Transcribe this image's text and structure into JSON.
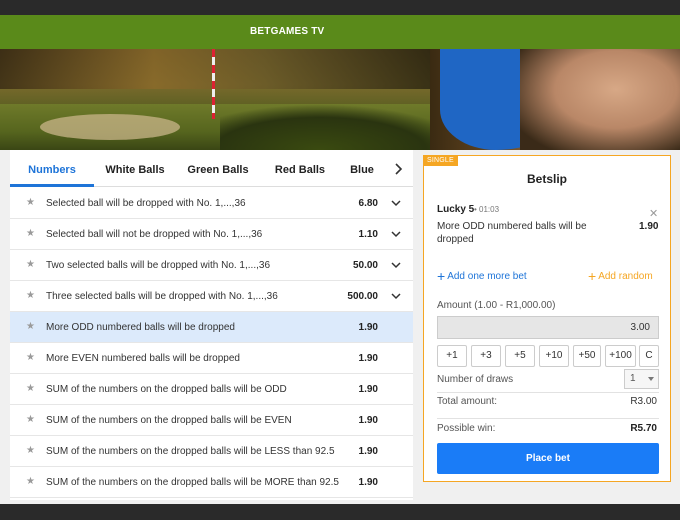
{
  "header": {
    "brand": "BETGAMES TV"
  },
  "tabs": [
    {
      "label": "Numbers",
      "active": true
    },
    {
      "label": "White Balls",
      "active": false
    },
    {
      "label": "Green Balls",
      "active": false
    },
    {
      "label": "Red Balls",
      "active": false
    },
    {
      "label": "Blue",
      "active": false
    }
  ],
  "bets": [
    {
      "label": "Selected ball will be dropped with No. 1,...,36",
      "odds": "6.80",
      "expandable": true
    },
    {
      "label": "Selected ball will not be dropped with No. 1,...,36",
      "odds": "1.10",
      "expandable": true
    },
    {
      "label": "Two selected balls will be dropped with No. 1,...,36",
      "odds": "50.00",
      "expandable": true
    },
    {
      "label": "Three selected balls will be dropped with No. 1,...,36",
      "odds": "500.00",
      "expandable": true
    },
    {
      "label": "More ODD numbered balls will be dropped",
      "odds": "1.90",
      "selected": true
    },
    {
      "label": "More EVEN numbered balls will be dropped",
      "odds": "1.90"
    },
    {
      "label": "SUM of the numbers on the dropped balls will be ODD",
      "odds": "1.90"
    },
    {
      "label": "SUM of the numbers on the dropped balls will be EVEN",
      "odds": "1.90"
    },
    {
      "label": "SUM of the numbers on the dropped balls will be LESS than 92.5",
      "odds": "1.90"
    },
    {
      "label": "SUM of the numbers on the dropped balls will be MORE than 92.5",
      "odds": "1.90"
    }
  ],
  "betslip": {
    "badge": "SINGLE",
    "title": "Betslip",
    "game": "Lucky 5",
    "time": "• 01:03",
    "selection": "More ODD numbered balls will be dropped",
    "odds": "1.90",
    "add_more_label": "Add one more bet",
    "add_random_label": "Add random",
    "amount_label": "Amount (1.00 - R1,000.00)",
    "amount_value": "3.00",
    "quick_buttons": [
      "+1",
      "+3",
      "+5",
      "+10",
      "+50",
      "+100",
      "C"
    ],
    "draws_label": "Number of draws",
    "draws_value": "1",
    "total_label": "Total amount:",
    "total_value": "R3.00",
    "win_label": "Possible win:",
    "win_value": "R5.70",
    "place_bet_label": "Place bet"
  },
  "colors": {
    "accent": "#1e74d8",
    "brand_green": "#5a8a1a",
    "betslip_border": "#f5a623",
    "place_bet": "#1a7cf7"
  }
}
